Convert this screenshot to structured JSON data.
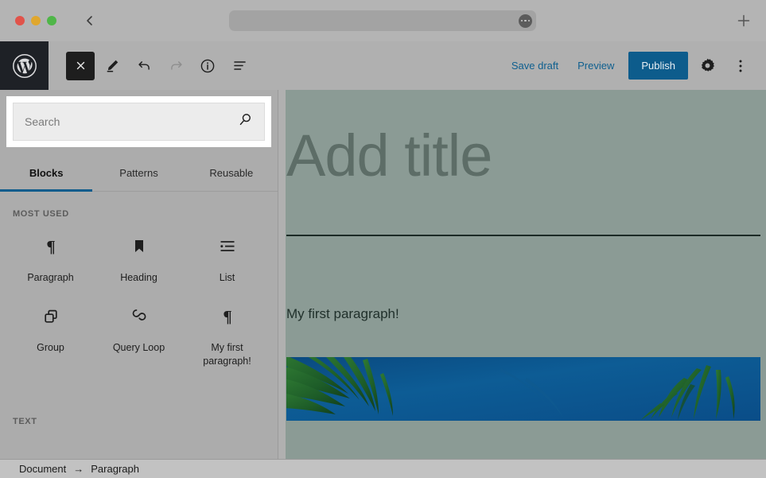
{
  "browser": {
    "traffic_lights": [
      "close",
      "minimize",
      "maximize"
    ],
    "back_label": "",
    "url_value": "",
    "url_menu_label": "",
    "new_tab_label": "",
    "colors": {
      "chrome_bg": "#b4b4b4",
      "url_bg": "#a3a3a3"
    }
  },
  "header": {
    "logo_label": "W",
    "tools": [
      {
        "name": "close-editor",
        "label": ""
      },
      {
        "name": "edit-tool",
        "label": ""
      },
      {
        "name": "undo",
        "label": ""
      },
      {
        "name": "redo",
        "label": ""
      },
      {
        "name": "details-info",
        "label": ""
      },
      {
        "name": "list-view",
        "label": ""
      }
    ],
    "save_draft_label": "Save draft",
    "preview_label": "Preview",
    "publish_label": "Publish",
    "settings_label": "",
    "more_menu_label": "",
    "colors": {
      "publish_bg": "#0d5c8c",
      "link": "#0e5f8f",
      "logo_bg": "#1e2126"
    }
  },
  "inserter": {
    "search": {
      "value": "",
      "placeholder": "Search"
    },
    "tabs": [
      {
        "label": "Blocks",
        "active": true
      },
      {
        "label": "Patterns",
        "active": false
      },
      {
        "label": "Reusable",
        "active": false
      }
    ],
    "sections": [
      {
        "label": "MOST USED",
        "blocks": [
          {
            "label": "Paragraph",
            "icon": "paragraph-icon"
          },
          {
            "label": "Heading",
            "icon": "heading-bookmark-icon"
          },
          {
            "label": "List",
            "icon": "list-icon"
          },
          {
            "label": "Group",
            "icon": "group-icon"
          },
          {
            "label": "Query Loop",
            "icon": "query-loop-icon"
          },
          {
            "label": "My first paragraph!",
            "icon": "paragraph-icon"
          }
        ]
      },
      {
        "label": "TEXT",
        "blocks": []
      }
    ]
  },
  "canvas": {
    "title_placeholder": "Add title",
    "paragraph_text": "My first paragraph!",
    "image_alt": "palm trees against blue sky",
    "colors": {
      "canvas_bg": "#8b9b95",
      "rule": "#1c2a26",
      "image_sky": "#0d5a93"
    }
  },
  "breadcrumb": {
    "items": [
      "Document",
      "Paragraph"
    ],
    "separator": "→"
  }
}
